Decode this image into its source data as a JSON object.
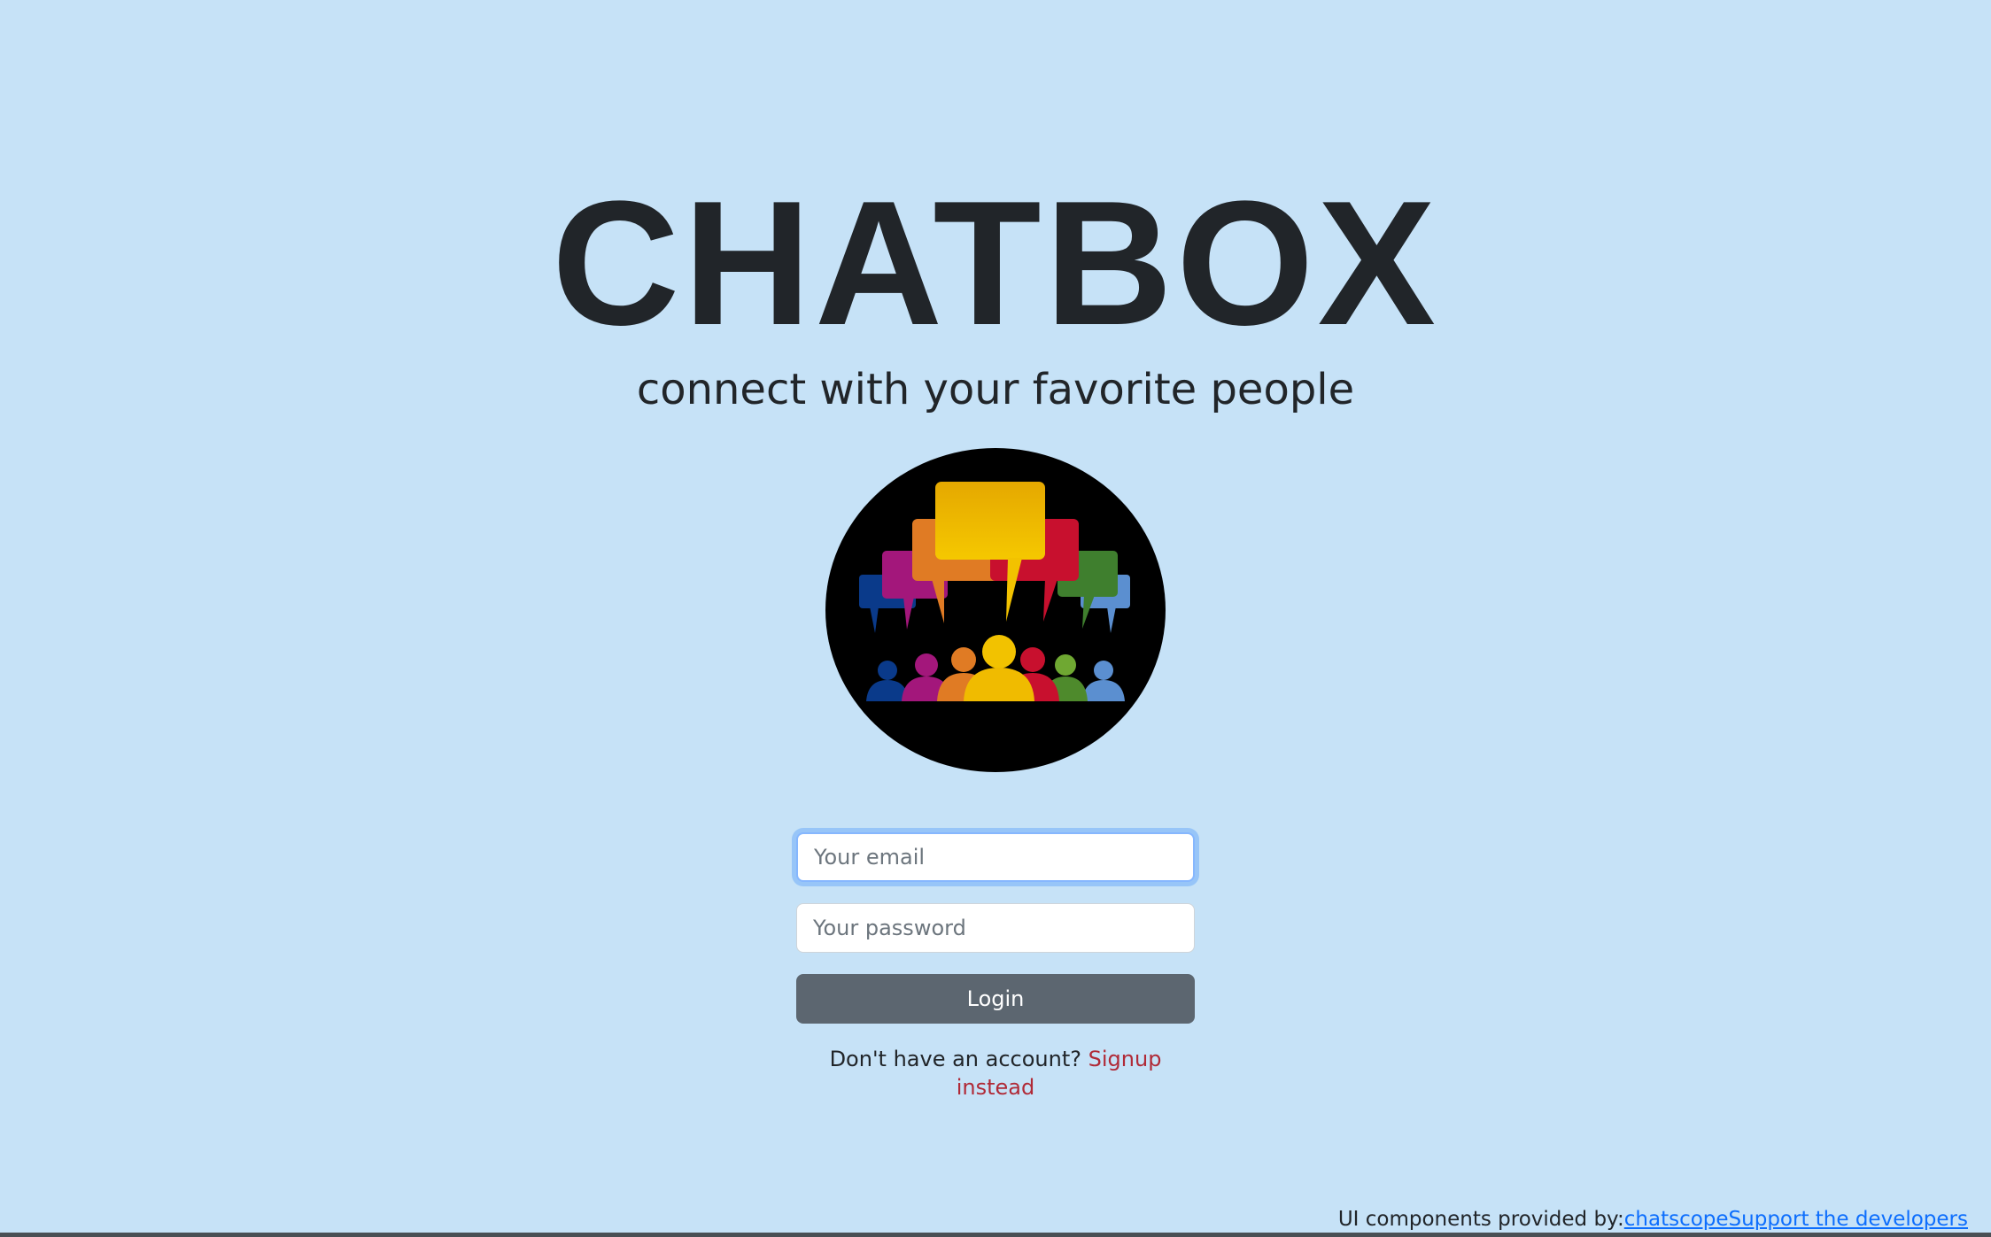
{
  "header": {
    "title": "CHATBOX",
    "subtitle": "connect with your favorite people"
  },
  "logo": {
    "icon": "chat-group-logo-icon",
    "background": "#000000",
    "colors": [
      "#0a3a8a",
      "#a3177b",
      "#e07b24",
      "#e8b400",
      "#c8102e",
      "#3f7f2e",
      "#5b8fd0"
    ]
  },
  "login_form": {
    "email_placeholder": "Your email",
    "password_placeholder": "Your password",
    "login_label": "Login",
    "signup_prompt": "Don't have an account?",
    "signup_link": "Signup instead"
  },
  "footer": {
    "credit_text": "UI components provided by:",
    "chatscope_link": "chatscope",
    "support_link": "Support the developers"
  },
  "colors": {
    "page_background": "#c6e2f7",
    "button": "#5c6670",
    "signup_link": "#b02a37",
    "footer_link": "#0d6efd"
  }
}
